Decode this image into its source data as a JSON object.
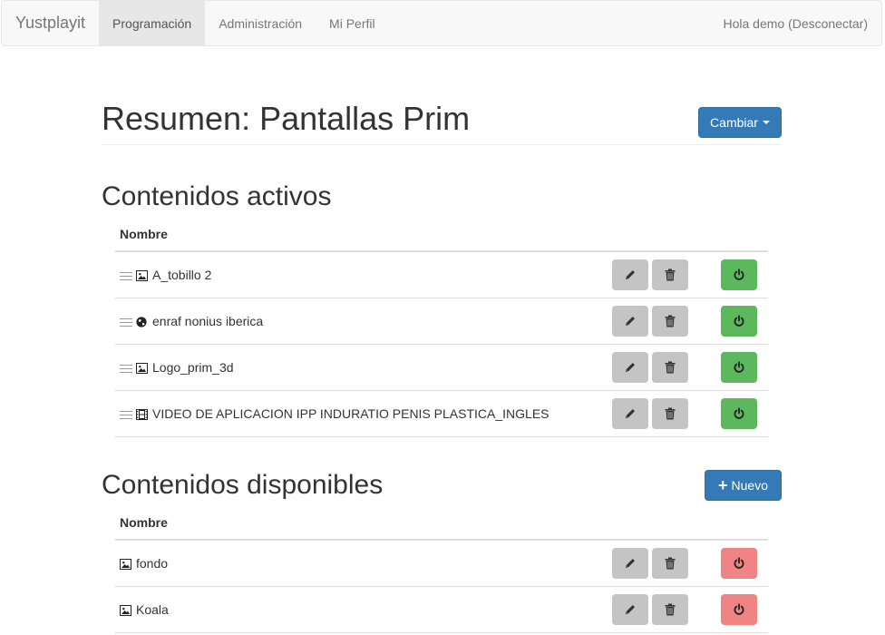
{
  "navbar": {
    "brand": "Yustplayit",
    "items": [
      {
        "label": "Programación",
        "active": true
      },
      {
        "label": "Administración",
        "active": false
      },
      {
        "label": "Mi Perfil",
        "active": false
      }
    ],
    "user_greeting": "Hola demo (Desconectar)"
  },
  "header": {
    "title": "Resumen: Pantallas Prim",
    "change_button": "Cambiar"
  },
  "active_section": {
    "title": "Contenidos activos",
    "column_header": "Nombre",
    "rows": [
      {
        "name": "A_tobillo 2",
        "icon": "image-icon"
      },
      {
        "name": "enraf nonius iberica",
        "icon": "globe-icon"
      },
      {
        "name": "Logo_prim_3d",
        "icon": "image-icon"
      },
      {
        "name": "VIDEO DE APLICACION IPP INDURATIO PENIS PLASTICA_INGLES",
        "icon": "film-icon"
      }
    ]
  },
  "available_section": {
    "title": "Contenidos disponibles",
    "new_button": "Nuevo",
    "column_header": "Nombre",
    "rows": [
      {
        "name": "fondo",
        "icon": "image-icon"
      },
      {
        "name": "Koala",
        "icon": "image-icon"
      }
    ]
  },
  "colors": {
    "primary": "#337ab7",
    "power_on": "#5cb85c",
    "power_off": "#f08484",
    "action_grey": "#c4c4c4"
  }
}
